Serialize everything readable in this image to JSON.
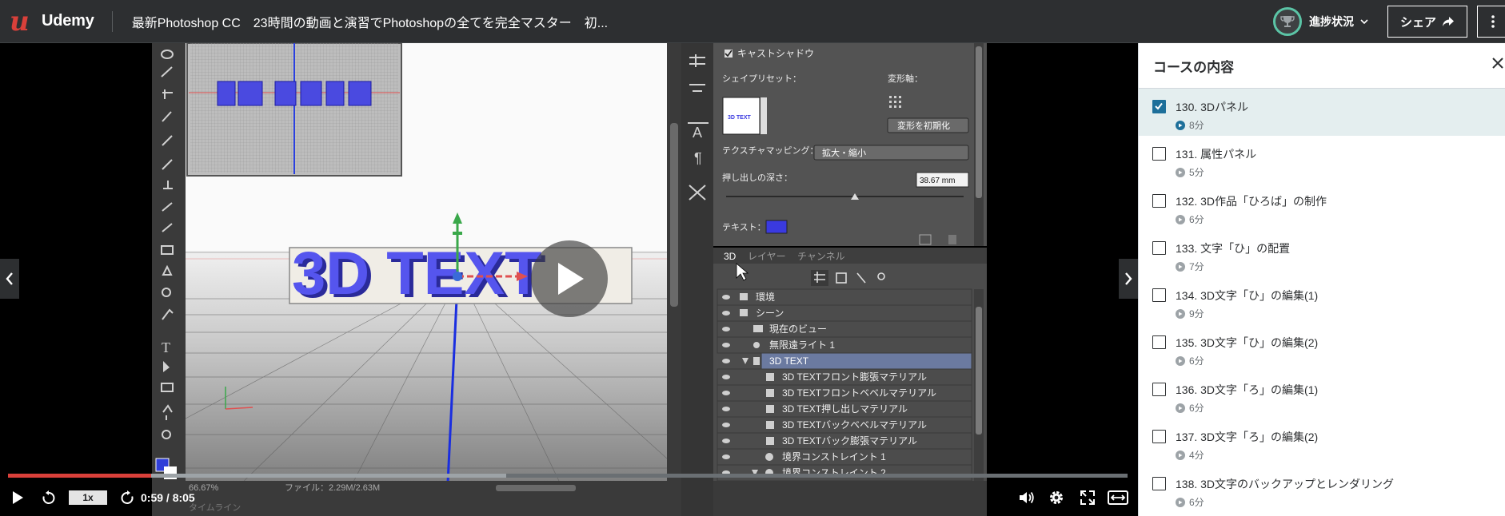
{
  "header": {
    "logo_text": "Udemy",
    "course_title": "最新Photoshop CC　23時間の動画と演習でPhotoshopの全てを完全マスター　初...",
    "progress_label": "進捗状況",
    "share_label": "シェア"
  },
  "video_frame": {
    "ps_checkbox_label": "キャストシャドウ",
    "shape_preset_label": "シェイプリセット：",
    "deform_axis_label": "変形軸：",
    "preset_thumb_text": "3D TEXT",
    "reset_deform_label": "変形を初期化",
    "texture_mapping_label": "テクスチャマッピング：",
    "texture_mapping_value": "拡大・縮小",
    "extrude_depth_label": "押し出しの深さ：",
    "extrude_depth_value": "38.67 mm",
    "text_label": "テキスト：",
    "tabs": [
      "3D",
      "レイヤー",
      "チャンネル"
    ],
    "scene_items": [
      "環境",
      "シーン",
      "現在のビュー",
      "無限遠ライト 1",
      "3D TEXT",
      "3D TEXTフロント膨張マテリアル",
      "3D TEXTフロントベベルマテリアル",
      "3D TEXT押し出しマテリアル",
      "3D TEXTバックベベルマテリアル",
      "3D TEXTバック膨張マテリアル",
      "境界コンストレイント 1",
      "境界コンストレイント 2"
    ],
    "status_zoom": "66.67%",
    "status_file": "ファイル：2.29M/2.63M",
    "timeline_label": "タイムライン",
    "canvas_text": "3D TEXT"
  },
  "player": {
    "speed": "1x",
    "time": "0:59 / 8:05",
    "progress_fraction": 0.128,
    "buffer_fraction": 0.445
  },
  "sidebar": {
    "title": "コースの内容",
    "lectures": [
      {
        "title": "130. 3Dパネル",
        "duration": "8分",
        "checked": true,
        "active": true
      },
      {
        "title": "131. 属性パネル",
        "duration": "5分",
        "checked": false,
        "active": false
      },
      {
        "title": "132. 3D作品「ひろば」の制作",
        "duration": "6分",
        "checked": false,
        "active": false
      },
      {
        "title": "133. 文字「ひ」の配置",
        "duration": "7分",
        "checked": false,
        "active": false
      },
      {
        "title": "134. 3D文字「ひ」の編集(1)",
        "duration": "9分",
        "checked": false,
        "active": false
      },
      {
        "title": "135. 3D文字「ひ」の編集(2)",
        "duration": "6分",
        "checked": false,
        "active": false
      },
      {
        "title": "136. 3D文字「ろ」の編集(1)",
        "duration": "6分",
        "checked": false,
        "active": false
      },
      {
        "title": "137. 3D文字「ろ」の編集(2)",
        "duration": "4分",
        "checked": false,
        "active": false
      },
      {
        "title": "138. 3D文字のバックアップとレンダリング",
        "duration": "6分",
        "checked": false,
        "active": false
      }
    ]
  },
  "colors": {
    "header_bg": "#2d2f31",
    "brand_red": "#d9403a",
    "progress_ring": "#5bc4a6",
    "checkbox_blue": "#1d6f9a",
    "active_row": "#e4eeef",
    "text_3d": "#4f4fe6"
  }
}
